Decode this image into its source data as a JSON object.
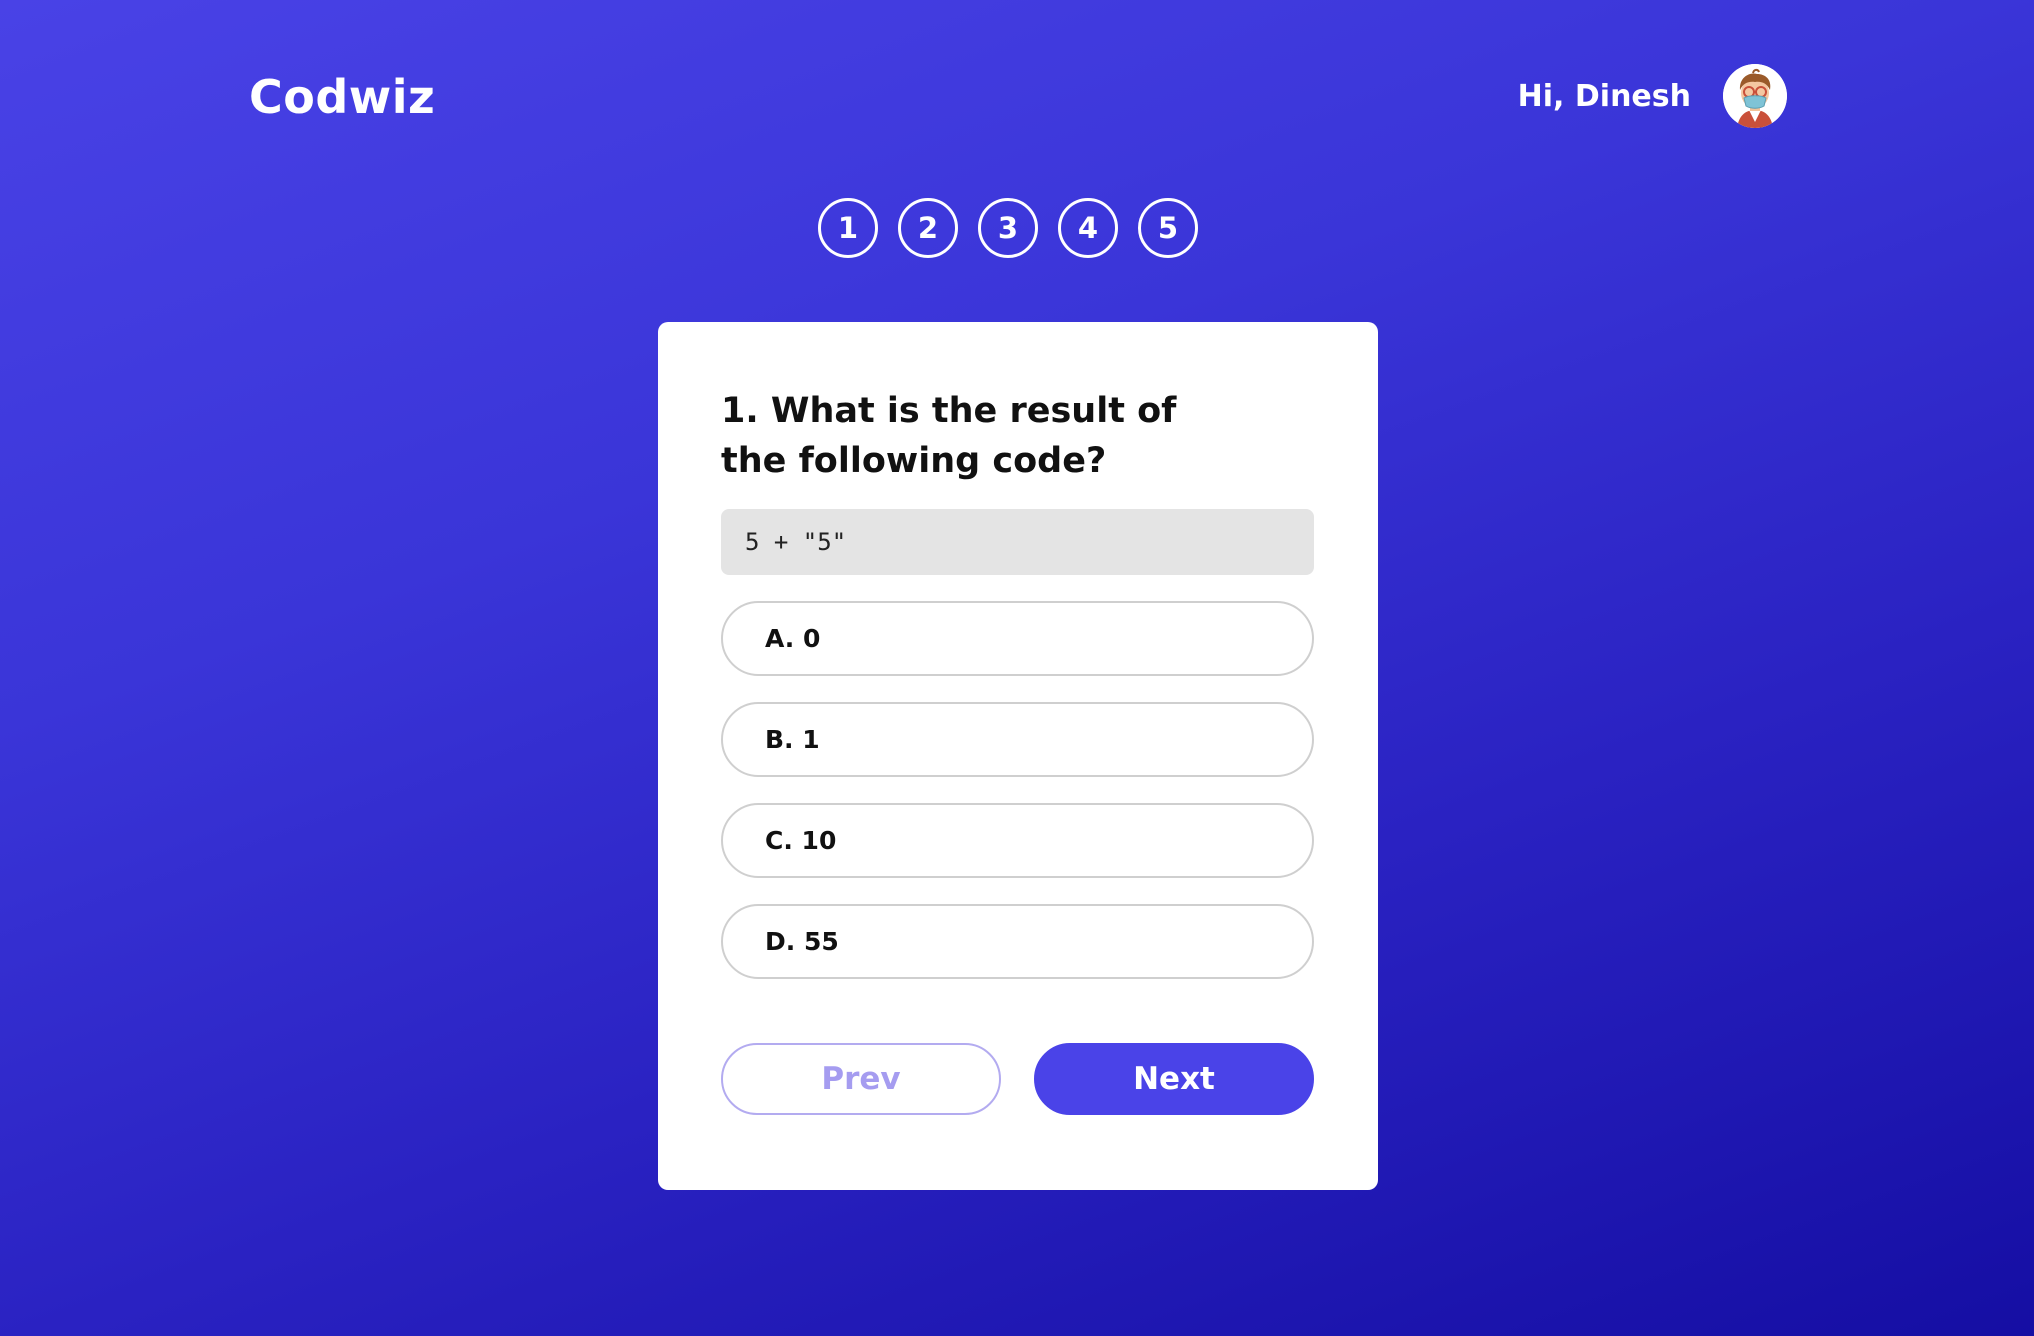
{
  "header": {
    "brand": "Codwiz",
    "greeting": "Hi, Dinesh",
    "avatar_icon": "user-avatar-icon"
  },
  "steps": [
    "1",
    "2",
    "3",
    "4",
    "5"
  ],
  "quiz": {
    "question": "1. What is the result of the following code?",
    "code": "5 + \"5\"",
    "options": [
      {
        "label": "A. 0"
      },
      {
        "label": "B. 1"
      },
      {
        "label": "C. 10"
      },
      {
        "label": "D. 55"
      }
    ],
    "prev_label": "Prev",
    "next_label": "Next"
  },
  "colors": {
    "background_start": "#4942e6",
    "background_end": "#150ea3",
    "accent": "#4a43e8",
    "prev_button_text": "#a59cf0"
  }
}
